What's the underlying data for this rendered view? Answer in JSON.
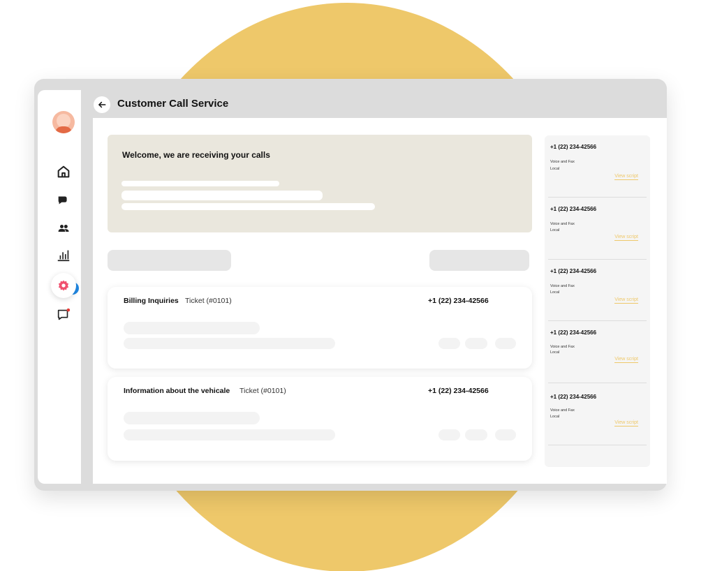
{
  "header": {
    "title": "Customer Call Service"
  },
  "sidebar": {
    "items": [
      {
        "icon": "home-icon"
      },
      {
        "icon": "chat-icon"
      },
      {
        "icon": "users-icon"
      },
      {
        "icon": "chart-icon"
      },
      {
        "icon": "settings-icon"
      },
      {
        "icon": "message-icon"
      }
    ]
  },
  "welcome": {
    "title": "Welcome, we are receiving your calls"
  },
  "tickets": [
    {
      "title": "Billing Inquiries",
      "ticket": "Ticket (#0101)",
      "phone": "+1 (22) 234-42566"
    },
    {
      "title": "Information about the vehicale",
      "ticket": "Ticket (#0101)",
      "phone": "+1 (22) 234-42566"
    }
  ],
  "scripts": [
    {
      "phone": "+1 (22) 234-42566",
      "line1": "Voice and Fax",
      "line2": "Local",
      "link": "View script"
    },
    {
      "phone": "+1 (22) 234-42566",
      "line1": "Voice and Fax",
      "line2": "Local",
      "link": "View script"
    },
    {
      "phone": "+1 (22) 234-42566",
      "line1": "Voice and Fax",
      "line2": "Local",
      "link": "View script"
    },
    {
      "phone": "+1 (22) 234-42566",
      "line1": "Voice and Fax",
      "line2": "Local",
      "link": "View script"
    },
    {
      "phone": "+1 (22) 234-42566",
      "line1": "Voice and Fax",
      "line2": "Local",
      "link": "View script"
    }
  ],
  "colors": {
    "accent": "#EEC86A",
    "settings_active": "#F0506E",
    "chat_badge": "#1F88E5"
  }
}
